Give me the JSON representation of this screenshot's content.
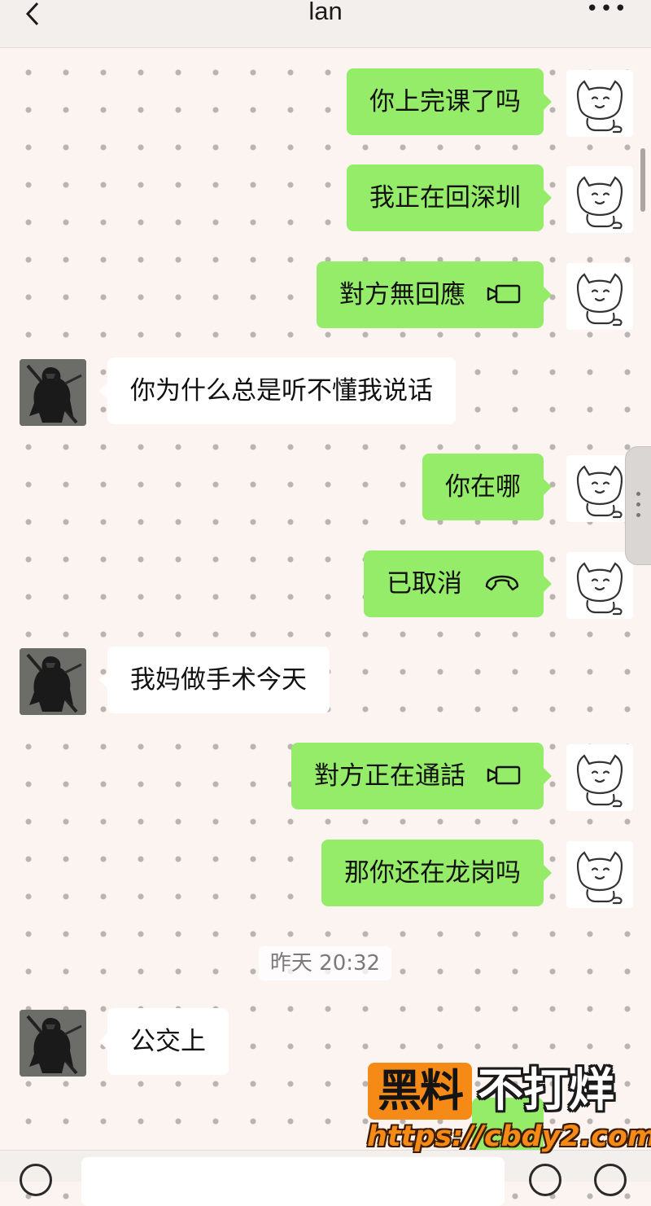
{
  "header": {
    "title": "lan",
    "back_icon": "chevron-left-icon",
    "more_label": "•••"
  },
  "messages": [
    {
      "side": "out",
      "text": "你上完课了吗"
    },
    {
      "side": "out",
      "text": "我正在回深圳"
    },
    {
      "side": "out",
      "text": "對方無回應",
      "icon": "video-call-icon"
    },
    {
      "side": "in",
      "text": "你为什么总是听不懂我说话"
    },
    {
      "side": "out",
      "text": "你在哪"
    },
    {
      "side": "out",
      "text": "已取消",
      "icon": "phone-hangup-icon"
    },
    {
      "side": "in",
      "text": "我妈做手术今天"
    },
    {
      "side": "out",
      "text": "對方正在通話",
      "icon": "video-call-icon"
    },
    {
      "side": "out",
      "text": "那你还在龙岗吗"
    },
    {
      "side": "in",
      "text": "公交上"
    }
  ],
  "timestamp": "昨天 20:32",
  "avatars": {
    "self": "cat-avatar",
    "contact": "dark-warrior-avatar"
  },
  "watermark": {
    "badge": "黑料",
    "text": "不打烊",
    "url": "https://cbdy2.com"
  },
  "colors": {
    "outgoing_bubble": "#95ec69",
    "incoming_bubble": "#ffffff",
    "background": "#fbf4f1",
    "watermark_accent": "#f58a17"
  }
}
